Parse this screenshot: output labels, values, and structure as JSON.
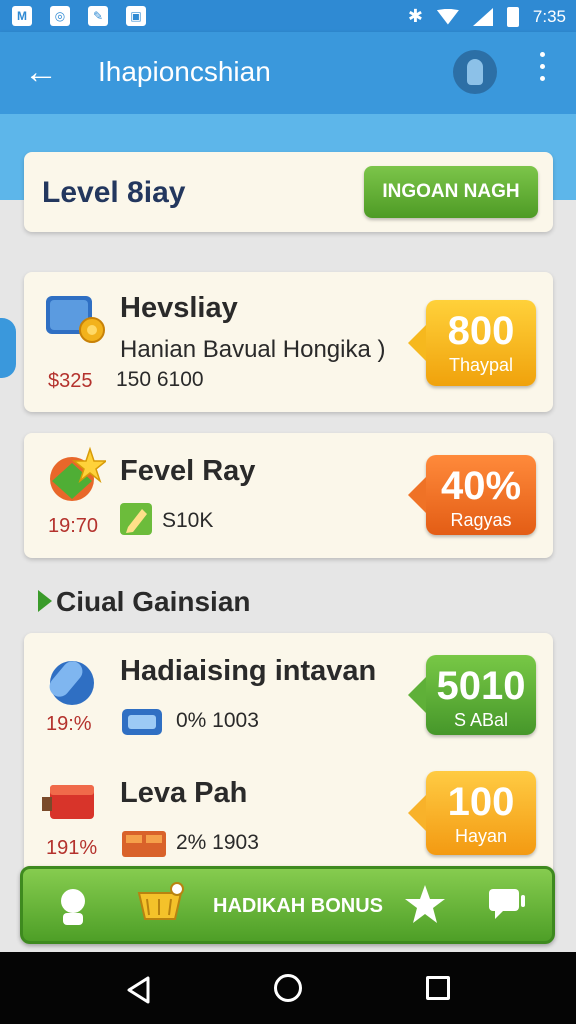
{
  "status_bar": {
    "left_icons": [
      "notification-icon",
      "whatsapp-icon",
      "app-icon",
      "gallery-icon"
    ],
    "left_glyphs": [
      "M",
      "◎",
      "✎",
      "▣"
    ],
    "time": "7:35",
    "bluetooth_glyph": "✱"
  },
  "app_bar": {
    "back_glyph": "←",
    "title": "Ihapioncshian"
  },
  "level_card": {
    "title": "Level 8iay",
    "button_label": "INGOAN NAGH"
  },
  "items": [
    {
      "title": "Hevsliay",
      "description": "Hanian Bavual Hongika )",
      "price": "$325",
      "sub": "150 6100",
      "badge_value": "800",
      "badge_label": "Thaypal"
    },
    {
      "title": "Fevel Ray",
      "price": "19:70",
      "sub": "S10K",
      "badge_value": "40%",
      "badge_label": "Ragyas"
    }
  ],
  "section": {
    "title": "Ciual Gainsian"
  },
  "section_items": [
    {
      "title": "Hadiaising intavan",
      "price": "19:%",
      "sub": "0% 1003",
      "badge_value": "5010",
      "badge_label": "S ABal"
    },
    {
      "title": "Leva Pah",
      "price": "191%",
      "sub": "2% 1903",
      "badge_value": "100",
      "badge_label": "Hayan"
    }
  ],
  "bottom_nav": {
    "label": "HADIKAH BONUS"
  },
  "colors": {
    "app_bar": "#3a98dc",
    "green": "#5fb038",
    "orange": "#ef7226",
    "yellow": "#f6b81e",
    "price_red": "#b4322d"
  }
}
